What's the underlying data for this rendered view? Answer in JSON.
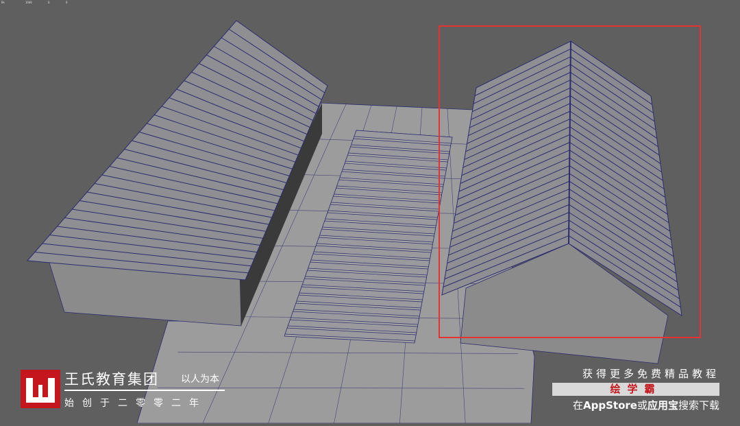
{
  "hud": {
    "label_a": "Bk",
    "label_b": "1600",
    "label_c": "0",
    "label_d": "0"
  },
  "colors": {
    "background": "#5f5f5f",
    "roof": "#8e8e93",
    "roof_dark": "#7f7f86",
    "wall": "#8b8b8b",
    "shadow": "#2f2f2f",
    "ground": "#9c9c9c",
    "wire": "#2c2c6e",
    "selection": "#e53333",
    "brand_red": "#c4161c"
  },
  "scene": {
    "left_roof_slats": 28,
    "right_roof_slats": 26,
    "walkway_planks": 25,
    "selection_box": "right building"
  },
  "logo": {
    "title": "王氏教育集团",
    "slogan": "以人为本",
    "founded": "始创于二零零二年",
    "mark": "W"
  },
  "promo": {
    "top": "获得更多免费精品教程",
    "brand": "绘学霸",
    "bottom_prefix": "在",
    "bottom_store": "AppStore",
    "bottom_or": "或",
    "bottom_app": "应用宝",
    "bottom_suffix": "搜索下载"
  }
}
